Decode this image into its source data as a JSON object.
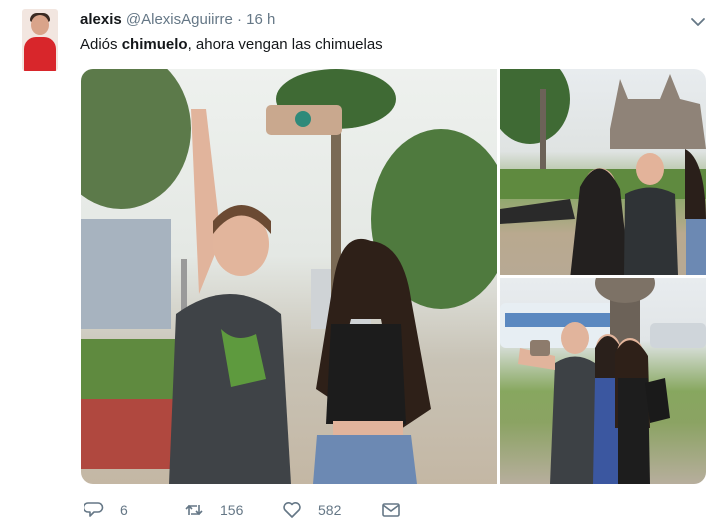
{
  "author": {
    "name": "alexis",
    "handle": "@AlexisAguiirre",
    "separator": "·",
    "time": "16 h"
  },
  "tweet": {
    "text_before": "Adiós ",
    "text_bold": "chimuelo",
    "text_after": ", ahora vengan las chimuelas"
  },
  "media": {
    "photo_count": 3
  },
  "actions": {
    "replies": "6",
    "retweets": "156",
    "likes": "582"
  },
  "icons": {
    "more": "chevron-down-icon",
    "reply": "reply-icon",
    "retweet": "retweet-icon",
    "like": "heart-icon",
    "dm": "envelope-icon"
  },
  "colors": {
    "text": "#14171a",
    "muted": "#657786",
    "avatar_shirt": "#d8262b"
  }
}
